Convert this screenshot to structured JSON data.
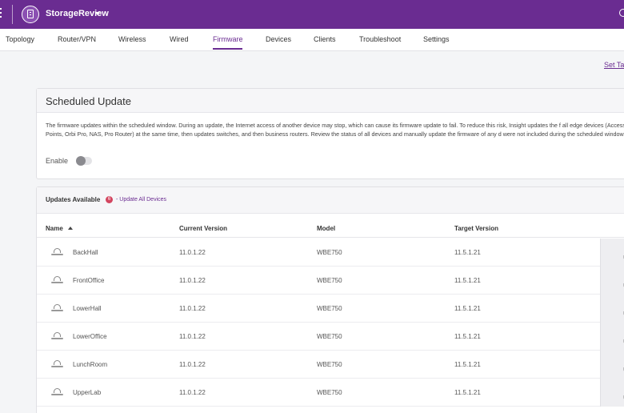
{
  "header": {
    "org_name": "StorageReview",
    "icons": [
      "menu-icon",
      "organization-icon",
      "chevron-down-icon",
      "search-icon"
    ]
  },
  "nav": {
    "tabs": [
      {
        "label": "Topology"
      },
      {
        "label": "Router/VPN"
      },
      {
        "label": "Wireless"
      },
      {
        "label": "Wired"
      },
      {
        "label": "Firmware",
        "active": true
      },
      {
        "label": "Devices"
      },
      {
        "label": "Clients"
      },
      {
        "label": "Troubleshoot"
      },
      {
        "label": "Settings"
      }
    ]
  },
  "toolbar": {
    "set_link": "Set Ta"
  },
  "scheduled": {
    "title": "Scheduled Update",
    "description": "The firmware updates within the scheduled window. During an update, the Internet access of another device may stop, which can cause its firmware update to fail. To reduce this risk, Insight updates the f all edge devices (Access Points, Orbi Pro, NAS, Pro Router) at the same time, then updates switches, and then business routers. Review the status of all devices and manually update the firmware of any d were not included during the scheduled window.",
    "enable_label": "Enable",
    "enabled": false
  },
  "updates": {
    "title": "Updates Available",
    "count": "6",
    "update_all_link": "- Update All Devices",
    "columns": {
      "name": "Name",
      "current": "Current Version",
      "model": "Model",
      "target": "Target Version"
    },
    "rows": [
      {
        "name": "BackHall",
        "current": "11.0.1.22",
        "model": "WBE750",
        "target": "11.5.1.21",
        "action": "U"
      },
      {
        "name": "FrontOffice",
        "current": "11.0.1.22",
        "model": "WBE750",
        "target": "11.5.1.21",
        "action": "U"
      },
      {
        "name": "LowerHall",
        "current": "11.0.1.22",
        "model": "WBE750",
        "target": "11.5.1.21",
        "action": "U"
      },
      {
        "name": "LowerOffice",
        "current": "11.0.1.22",
        "model": "WBE750",
        "target": "11.5.1.21",
        "action": "U"
      },
      {
        "name": "LunchRoom",
        "current": "11.0.1.22",
        "model": "WBE750",
        "target": "11.5.1.21",
        "action": "U"
      },
      {
        "name": "UpperLab",
        "current": "11.0.1.22",
        "model": "WBE750",
        "target": "11.5.1.21",
        "action": "U"
      }
    ]
  },
  "colors": {
    "brand": "#6a2c91",
    "badge": "#d3455f"
  }
}
